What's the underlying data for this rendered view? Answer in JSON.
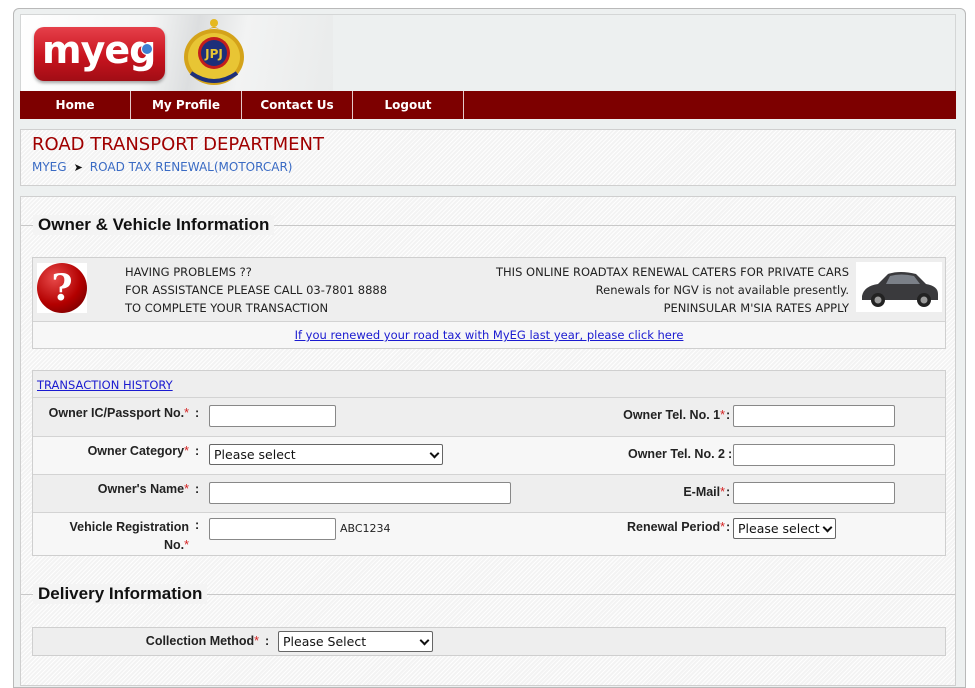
{
  "header": {
    "brand_logo_text": "myeg",
    "agency_logo_text": "JPJ"
  },
  "nav": {
    "items": [
      {
        "label": "Home"
      },
      {
        "label": "My Profile"
      },
      {
        "label": "Contact Us"
      },
      {
        "label": "Logout"
      }
    ]
  },
  "page": {
    "title": "ROAD TRANSPORT DEPARTMENT",
    "breadcrumb": [
      {
        "label": "MYEG"
      },
      {
        "label": "ROAD TAX RENEWAL(MOTORCAR)"
      }
    ],
    "breadcrumb_separator": "➤"
  },
  "owner_section": {
    "legend": "Owner & Vehicle Information",
    "help": {
      "icon": "question-icon",
      "icon_glyph": "?",
      "lines": [
        "HAVING PROBLEMS ??",
        "FOR ASSISTANCE PLEASE CALL 03-7801 8888",
        "TO COMPLETE YOUR TRANSACTION"
      ]
    },
    "notice": {
      "lines": [
        "THIS ONLINE ROADTAX RENEWAL CATERS FOR PRIVATE CARS",
        "Renewals for NGV is not available presently.",
        "PENINSULAR M'SIA RATES APPLY"
      ],
      "image": "car-image"
    },
    "renew_link": "If you renewed your road tax with MyEG last year, please click here",
    "history_link": "TRANSACTION HISTORY",
    "required_mark": "*",
    "colon": ":",
    "fields": {
      "ic": {
        "label": "Owner IC/Passport No.",
        "value": ""
      },
      "category": {
        "label": "Owner Category",
        "selected": "Please select"
      },
      "name": {
        "label": "Owner's Name",
        "value": ""
      },
      "vehicle_reg": {
        "label_line1": "Vehicle Registration",
        "label_line2": "No.",
        "value": "",
        "hint": "ABC1234"
      },
      "tel1": {
        "label": "Owner Tel. No. 1",
        "value": ""
      },
      "tel2": {
        "label": "Owner Tel. No. 2",
        "value": ""
      },
      "email": {
        "label": "E-Mail",
        "value": ""
      },
      "renewal_period": {
        "label": "Renewal Period",
        "selected": "Please select"
      }
    }
  },
  "delivery_section": {
    "legend": "Delivery Information",
    "collection_method": {
      "label": "Collection Method",
      "selected": "Please Select"
    }
  },
  "colors": {
    "nav_bg": "#7d0000",
    "title": "#a00000",
    "breadcrumb": "#3a6bc4",
    "link": "#1a1ad0",
    "required": "#d42020"
  }
}
